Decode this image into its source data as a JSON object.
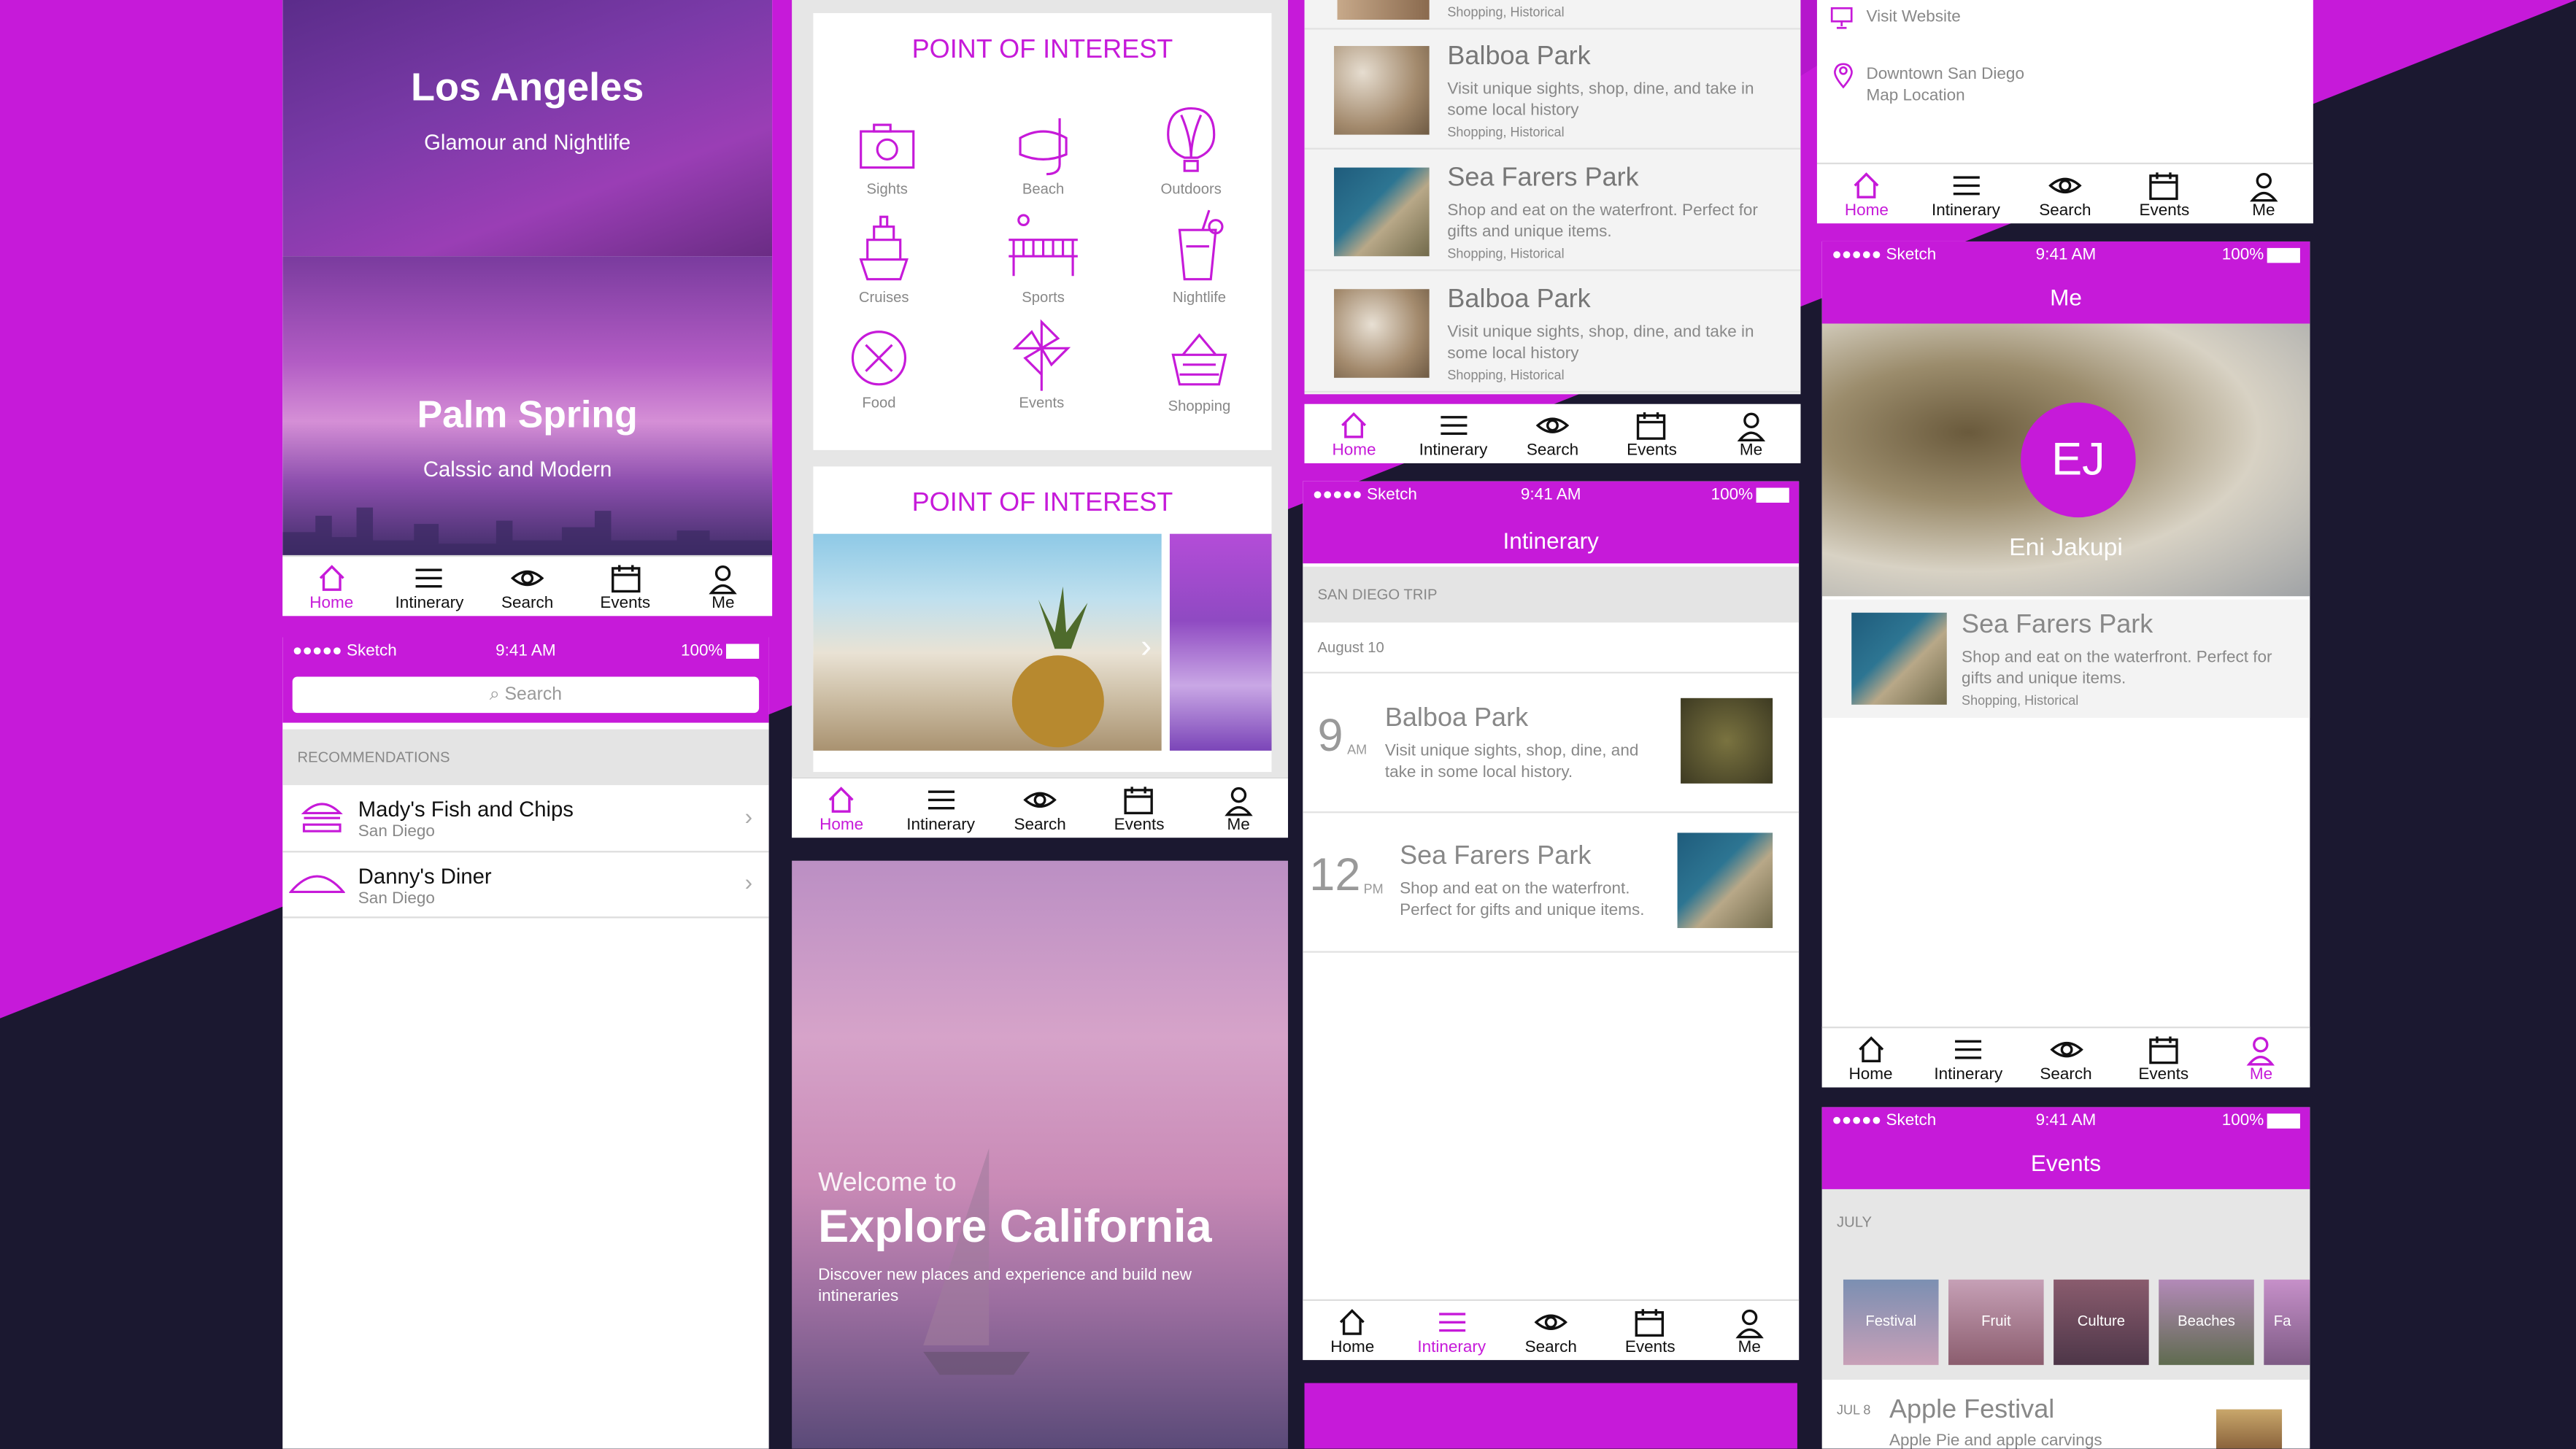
{
  "tabs": {
    "home": "Home",
    "itinerary": "Intinerary",
    "search": "Search",
    "events": "Events",
    "me": "Me"
  },
  "status": {
    "carrier": "●●●●● Sketch",
    "time": "9:41 AM",
    "battery": "100%"
  },
  "cities": [
    {
      "name": "Los Angeles",
      "tagline": "Glamour and Nightlife"
    },
    {
      "name": "Palm Spring",
      "tagline": "Calssic and Modern"
    }
  ],
  "search": {
    "placeholder": "Search",
    "section": "RECOMMENDATIONS",
    "items": [
      {
        "name": "Mady's Fish and Chips",
        "city": "San Diego"
      },
      {
        "name": "Danny's Diner",
        "city": "San Diego"
      }
    ]
  },
  "poi": {
    "title": "POINT OF INTEREST",
    "categories": [
      "Sights",
      "Beach",
      "Outdoors",
      "Cruises",
      "Sports",
      "Nightlife",
      "Food",
      "Events",
      "Shopping"
    ]
  },
  "poi2": {
    "title": "POINT OF INTEREST"
  },
  "welcome": {
    "welcome": "Welcome to",
    "title": "Explore California",
    "subtitle": "Discover new places and experience and build new intineraries"
  },
  "places": [
    {
      "name": "Balboa Park",
      "desc": "Visit unique sights, shop, dine, and take in some local history",
      "tags": "Shopping, Historical"
    },
    {
      "name": "Sea Farers Park",
      "desc": "Shop and eat on the waterfront. Perfect for gifts and unique items.",
      "tags": "Shopping, Historical"
    },
    {
      "name": "Balboa Park",
      "desc": "Visit unique sights, shop, dine, and take in some local history",
      "tags": "Shopping, Historical"
    }
  ],
  "places_top_tag": "Shopping, Historical",
  "itinerary": {
    "title": "Intinerary",
    "trip": "SAN DIEGO TRIP",
    "date": "August 10",
    "items": [
      {
        "hour": "9",
        "ampm": "AM",
        "name": "Balboa Park",
        "desc": "Visit unique sights, shop, dine, and take in some local history."
      },
      {
        "hour": "12",
        "ampm": "PM",
        "name": "Sea Farers Park",
        "desc": "Shop and eat on the waterfront. Perfect for gifts and unique items."
      }
    ]
  },
  "detail": {
    "website": "Visit Website",
    "location_line1": "Downtown San Diego",
    "location_line2": "Map Location"
  },
  "me": {
    "title": "Me",
    "initials": "EJ",
    "name": "Eni Jakupi",
    "fav": {
      "name": "Sea Farers Park",
      "desc": "Shop and eat on the waterfront. Perfect for gifts and unique items.",
      "tags": "Shopping, Historical"
    }
  },
  "events": {
    "title": "Events",
    "month": "JULY",
    "cats": [
      "Festival",
      "Fruit",
      "Culture",
      "Beaches",
      "Fa"
    ],
    "first": {
      "date": "JUL 8",
      "name": "Apple Festival",
      "desc": "Apple Pie and apple carvings"
    }
  },
  "colors": {
    "accent": "#c61ad9",
    "background": "#1b1830"
  }
}
